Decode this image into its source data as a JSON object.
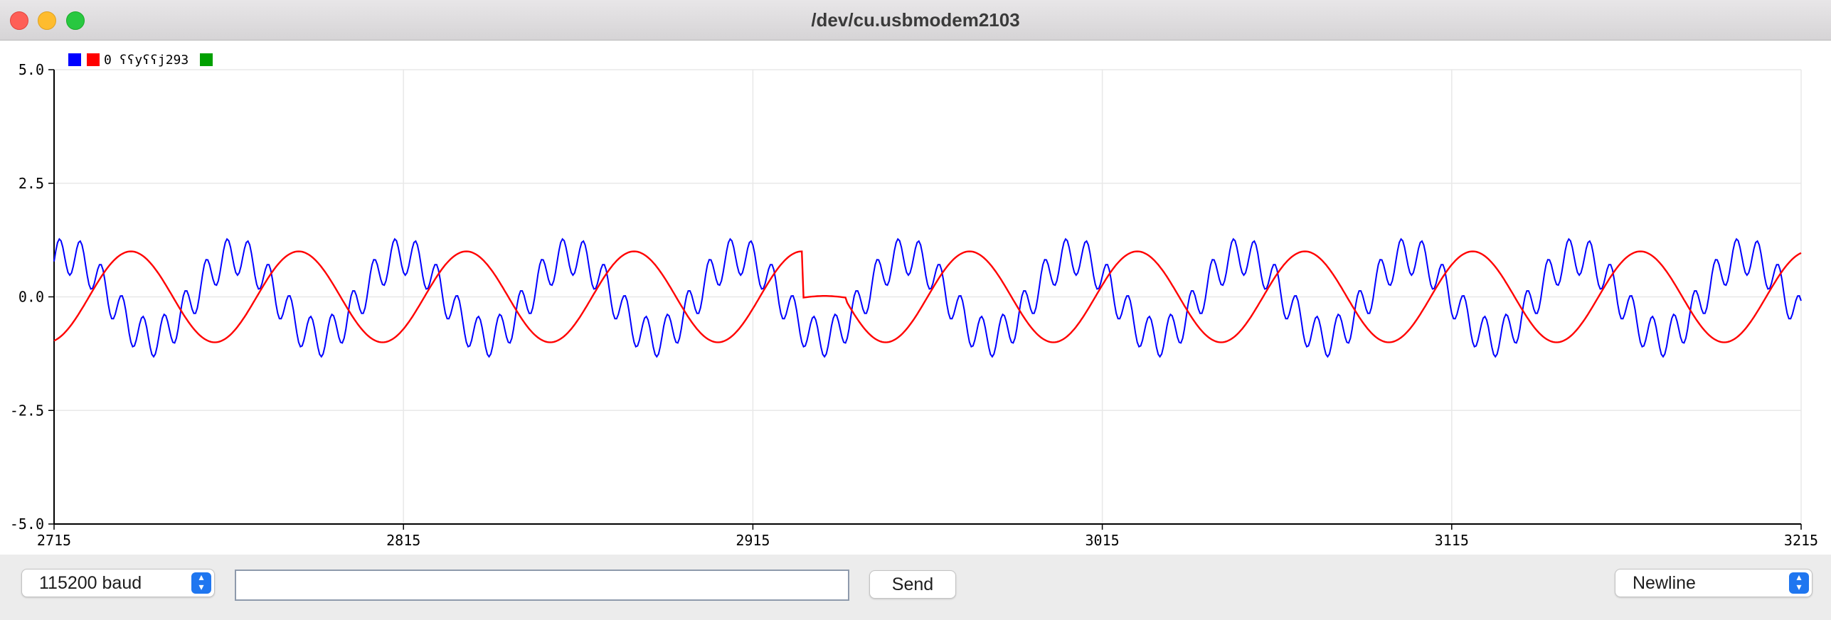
{
  "window": {
    "title": "/dev/cu.usbmodem2103"
  },
  "legend": {
    "label": "0 ʕʕyʕʕj293"
  },
  "colors": {
    "series1": "#0000ff",
    "series2": "#ff0000",
    "series3": "#00a000",
    "grid": "#e8e8e8",
    "axis": "#000000"
  },
  "chart_data": {
    "type": "line",
    "xlim": [
      2715,
      3215
    ],
    "ylim": [
      -5.0,
      5.0
    ],
    "xticks": [
      "2715",
      "2815",
      "2915",
      "3015",
      "3115",
      "3215"
    ],
    "yticks": [
      "5.0",
      "2.5",
      "0.0",
      "-2.5",
      "-5.0"
    ],
    "grid": true,
    "legend_position": "top-left",
    "series": [
      {
        "color": "blue",
        "description_values": {
          "waveform": "sine period ~48 samples amplitude ~0.9 with ~6-sample ripple amplitude ~0.4"
        }
      },
      {
        "color": "red",
        "description_values": {
          "waveform": "sine period ~48 samples amplitude 1.0, flat near 0.0 around x 2930-2940"
        }
      },
      {
        "color": "green"
      }
    ]
  },
  "bottom_bar": {
    "baud": "115200 baud",
    "message_value": "",
    "send_label": "Send",
    "line_ending": "Newline"
  }
}
